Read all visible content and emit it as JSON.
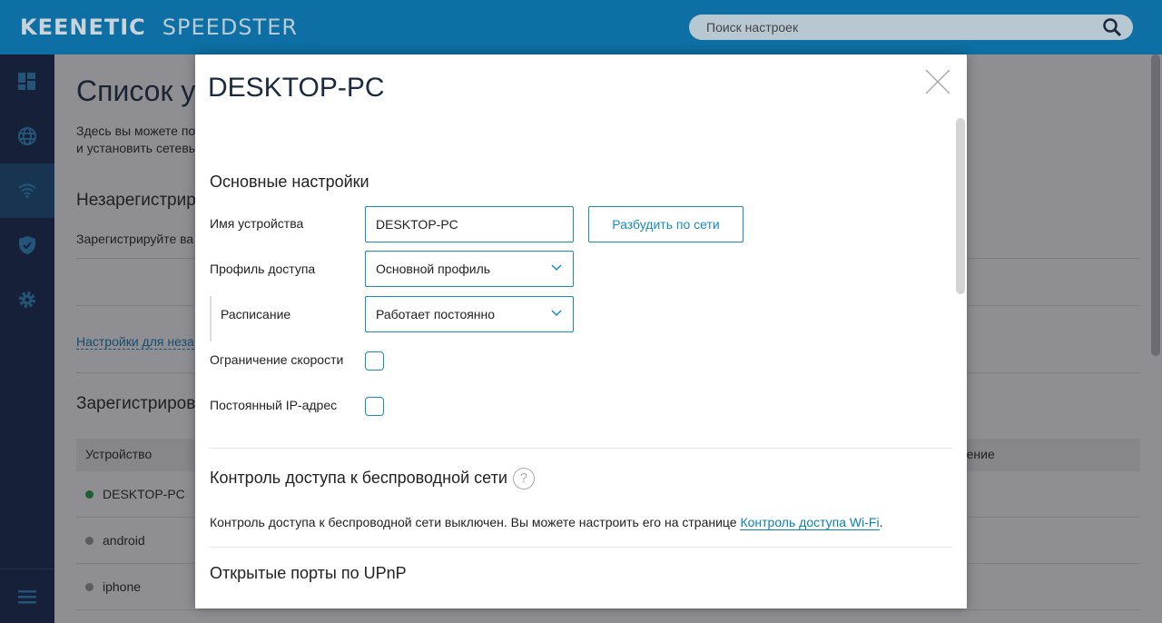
{
  "header": {
    "brand": "KEENETIC",
    "model": "SPEEDSTER",
    "search_placeholder": "Поиск настроек",
    "search_icon": "search-icon"
  },
  "sidebar": {
    "items": [
      {
        "icon": "dashboard-icon"
      },
      {
        "icon": "globe-icon"
      },
      {
        "icon": "wifi-icon",
        "active": true
      },
      {
        "icon": "shield-icon"
      },
      {
        "icon": "gear-icon"
      }
    ],
    "menu_icon": "hamburger-icon"
  },
  "page": {
    "title": "Список у",
    "desc1": "Здесь вы можете по",
    "desc2": "и установить сетевы",
    "unreg_title": "Незарегистриро",
    "unreg_text": "Зарегистрируйте ва",
    "unreg_link": "Настройки для неза",
    "reg_title": "Зарегистрирова",
    "table": {
      "col_device": "Устройство",
      "col_limit": "аничение",
      "rows": [
        {
          "name": "DESKTOP-PC",
          "status": "online"
        },
        {
          "name": "android",
          "status": "offline"
        },
        {
          "name": "iphone",
          "status": "offline"
        }
      ]
    }
  },
  "modal": {
    "title": "DESKTOP-PC",
    "basic_title": "Основные настройки",
    "device_name_label": "Имя устройства",
    "device_name_value": "DESKTOP-PC",
    "wake_button": "Разбудить по сети",
    "profile_label": "Профиль доступа",
    "profile_value": "Основной профиль",
    "schedule_label": "Расписание",
    "schedule_value": "Работает постоянно",
    "speed_limit_label": "Ограничение скорости",
    "speed_limit_checked": false,
    "static_ip_label": "Постоянный IP-адрес",
    "static_ip_checked": false,
    "wifi_acl_title": "Контроль доступа к беспроводной сети",
    "help": "?",
    "wifi_acl_text": "Контроль доступа к беспроводной сети выключен. Вы можете настроить его на странице ",
    "wifi_acl_link": "Контроль доступа Wi-Fi",
    "wifi_acl_end": ".",
    "upnp_title": "Открытые порты по UPnP"
  },
  "colors": {
    "header": "#0d6fa3",
    "sidebar": "#0f2348",
    "accent": "#1a8cbc",
    "online": "#1e9e3e",
    "offline": "#999999"
  }
}
